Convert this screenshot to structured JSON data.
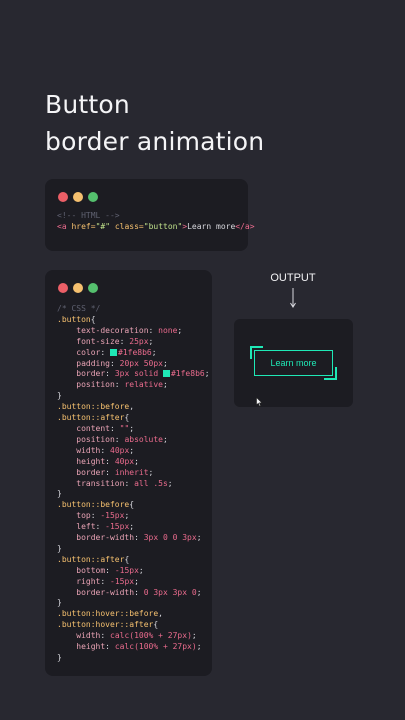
{
  "heading": {
    "line1": "Button",
    "line2": "border animation"
  },
  "window_dots": {
    "colors": [
      "#ec5f67",
      "#f5c06f",
      "#55c06e"
    ],
    "icons": [
      "close-dot",
      "minimize-dot",
      "maximize-dot"
    ]
  },
  "html_snippet": {
    "comment": "<!-- HTML -->",
    "open_tag": "<a",
    "href_attr": "href=",
    "href_value": "\"#\"",
    "class_attr": "class=",
    "class_value": "\"button\"",
    "tag_end": ">",
    "link_text": "Learn more",
    "close_tag": "</a>"
  },
  "css_snippet": {
    "lines": [
      [
        {
          "t": "/* CSS */",
          "c": "comment"
        }
      ],
      [
        {
          "t": ".button",
          "c": "sel"
        },
        {
          "t": "{",
          "c": "punc"
        }
      ],
      [
        {
          "t": "    text-decoration",
          "c": "prop"
        },
        {
          "t": ": ",
          "c": "punc"
        },
        {
          "t": "none",
          "c": "val"
        },
        {
          "t": ";",
          "c": "punc"
        }
      ],
      [
        {
          "t": "    font-size",
          "c": "prop"
        },
        {
          "t": ": ",
          "c": "punc"
        },
        {
          "t": "25px",
          "c": "val"
        },
        {
          "t": ";",
          "c": "punc"
        }
      ],
      [
        {
          "t": "    color",
          "c": "prop"
        },
        {
          "t": ": ",
          "c": "punc"
        },
        {
          "t": "",
          "c": "swatch"
        },
        {
          "t": "#1fe8b6",
          "c": "val"
        },
        {
          "t": ";",
          "c": "punc"
        }
      ],
      [
        {
          "t": "    padding",
          "c": "prop"
        },
        {
          "t": ": ",
          "c": "punc"
        },
        {
          "t": "20px 50px",
          "c": "val"
        },
        {
          "t": ";",
          "c": "punc"
        }
      ],
      [
        {
          "t": "    border",
          "c": "prop"
        },
        {
          "t": ": ",
          "c": "punc"
        },
        {
          "t": "3px solid ",
          "c": "val"
        },
        {
          "t": "",
          "c": "swatch"
        },
        {
          "t": "#1fe8b6",
          "c": "val"
        },
        {
          "t": ";",
          "c": "punc"
        }
      ],
      [
        {
          "t": "    position",
          "c": "prop"
        },
        {
          "t": ": ",
          "c": "punc"
        },
        {
          "t": "relative",
          "c": "val"
        },
        {
          "t": ";",
          "c": "punc"
        }
      ],
      [
        {
          "t": "}",
          "c": "punc"
        }
      ],
      [
        {
          "t": ".button::before",
          "c": "sel"
        },
        {
          "t": ",",
          "c": "punc"
        }
      ],
      [
        {
          "t": ".button::after",
          "c": "sel"
        },
        {
          "t": "{",
          "c": "punc"
        }
      ],
      [
        {
          "t": "    content",
          "c": "prop"
        },
        {
          "t": ": ",
          "c": "punc"
        },
        {
          "t": "\"\"",
          "c": "val"
        },
        {
          "t": ";",
          "c": "punc"
        }
      ],
      [
        {
          "t": "    position",
          "c": "prop"
        },
        {
          "t": ": ",
          "c": "punc"
        },
        {
          "t": "absolute",
          "c": "val"
        },
        {
          "t": ";",
          "c": "punc"
        }
      ],
      [
        {
          "t": "    width",
          "c": "prop"
        },
        {
          "t": ": ",
          "c": "punc"
        },
        {
          "t": "40px",
          "c": "val"
        },
        {
          "t": ";",
          "c": "punc"
        }
      ],
      [
        {
          "t": "    height",
          "c": "prop"
        },
        {
          "t": ": ",
          "c": "punc"
        },
        {
          "t": "40px",
          "c": "val"
        },
        {
          "t": ";",
          "c": "punc"
        }
      ],
      [
        {
          "t": "    border",
          "c": "prop"
        },
        {
          "t": ": ",
          "c": "punc"
        },
        {
          "t": "inherit",
          "c": "val"
        },
        {
          "t": ";",
          "c": "punc"
        }
      ],
      [
        {
          "t": "    transition",
          "c": "prop"
        },
        {
          "t": ": ",
          "c": "punc"
        },
        {
          "t": "all .5s",
          "c": "val"
        },
        {
          "t": ";",
          "c": "punc"
        }
      ],
      [
        {
          "t": "}",
          "c": "punc"
        }
      ],
      [
        {
          "t": ".button::before",
          "c": "sel"
        },
        {
          "t": "{",
          "c": "punc"
        }
      ],
      [
        {
          "t": "    top",
          "c": "prop"
        },
        {
          "t": ": ",
          "c": "punc"
        },
        {
          "t": "-15px",
          "c": "val"
        },
        {
          "t": ";",
          "c": "punc"
        }
      ],
      [
        {
          "t": "    left",
          "c": "prop"
        },
        {
          "t": ": ",
          "c": "punc"
        },
        {
          "t": "-15px",
          "c": "val"
        },
        {
          "t": ";",
          "c": "punc"
        }
      ],
      [
        {
          "t": "    border-width",
          "c": "prop"
        },
        {
          "t": ": ",
          "c": "punc"
        },
        {
          "t": "3px 0 0 3px",
          "c": "val"
        },
        {
          "t": ";",
          "c": "punc"
        }
      ],
      [
        {
          "t": "}",
          "c": "punc"
        }
      ],
      [
        {
          "t": ".button::after",
          "c": "sel"
        },
        {
          "t": "{",
          "c": "punc"
        }
      ],
      [
        {
          "t": "    bottom",
          "c": "prop"
        },
        {
          "t": ": ",
          "c": "punc"
        },
        {
          "t": "-15px",
          "c": "val"
        },
        {
          "t": ";",
          "c": "punc"
        }
      ],
      [
        {
          "t": "    right",
          "c": "prop"
        },
        {
          "t": ": ",
          "c": "punc"
        },
        {
          "t": "-15px",
          "c": "val"
        },
        {
          "t": ";",
          "c": "punc"
        }
      ],
      [
        {
          "t": "    border-width",
          "c": "prop"
        },
        {
          "t": ": ",
          "c": "punc"
        },
        {
          "t": "0 3px 3px 0",
          "c": "val"
        },
        {
          "t": ";",
          "c": "punc"
        }
      ],
      [
        {
          "t": "}",
          "c": "punc"
        }
      ],
      [
        {
          "t": ".button:hover::before",
          "c": "sel"
        },
        {
          "t": ",",
          "c": "punc"
        }
      ],
      [
        {
          "t": ".button:hover::after",
          "c": "sel"
        },
        {
          "t": "{",
          "c": "punc"
        }
      ],
      [
        {
          "t": "    width",
          "c": "prop"
        },
        {
          "t": ": ",
          "c": "punc"
        },
        {
          "t": "calc(100% + 27px)",
          "c": "val"
        },
        {
          "t": ";",
          "c": "punc"
        }
      ],
      [
        {
          "t": "    height",
          "c": "prop"
        },
        {
          "t": ": ",
          "c": "punc"
        },
        {
          "t": "calc(100% + 27px)",
          "c": "val"
        },
        {
          "t": ";",
          "c": "punc"
        }
      ],
      [
        {
          "t": "}",
          "c": "punc"
        }
      ]
    ]
  },
  "output": {
    "label": "OUTPUT",
    "button_text": "Learn more",
    "accent": "#1fe8b6"
  }
}
